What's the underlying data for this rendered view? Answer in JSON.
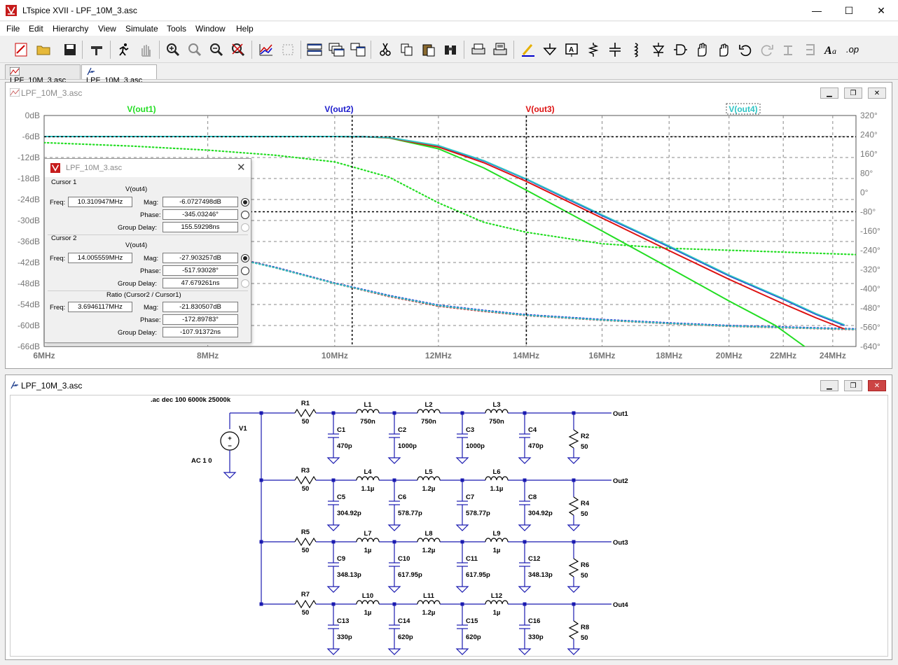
{
  "window": {
    "title": "LTspice XVII - LPF_10M_3.asc",
    "minimize": "—",
    "maximize": "☐",
    "close": "✕"
  },
  "menu": [
    "File",
    "Edit",
    "Hierarchy",
    "View",
    "Simulate",
    "Tools",
    "Window",
    "Help"
  ],
  "tabs": [
    "LPF_10M_3.asc",
    "LPF_10M_3.asc"
  ],
  "plot_window": {
    "title": "LPF_10M_3.asc",
    "colors": {
      "out1": "#22dd22",
      "out2": "#1a1acc",
      "out3": "#dd1111",
      "out4": "#2ec4c4"
    }
  },
  "chart_data": {
    "type": "line",
    "xlabel": "",
    "ylabel": "",
    "x_ticks": [
      "6MHz",
      "8MHz",
      "10MHz",
      "12MHz",
      "14MHz",
      "16MHz",
      "18MHz",
      "20MHz",
      "22MHz",
      "24MHz"
    ],
    "y_ticks": [
      "0dB",
      "-6dB",
      "-12dB",
      "-18dB",
      "-24dB",
      "-30dB",
      "-36dB",
      "-42dB",
      "-48dB",
      "-54dB",
      "-60dB",
      "-66dB"
    ],
    "y2_ticks": [
      "320°",
      "240°",
      "160°",
      "80°",
      "0°",
      "-80°",
      "-160°",
      "-240°",
      "-320°",
      "-400°",
      "-480°",
      "-560°",
      "-640°"
    ],
    "xlim_mhz": [
      6,
      25
    ],
    "ylim_db": [
      -66,
      0
    ],
    "y2lim_deg": [
      -640,
      320
    ],
    "log_x": true,
    "grid": true,
    "series": [
      {
        "name": "V(out1)",
        "color": "#22dd22",
        "mag_db": [
          [
            6,
            -6
          ],
          [
            10,
            -6
          ],
          [
            10.5,
            -6.05
          ],
          [
            11,
            -6.4
          ],
          [
            12,
            -9.5
          ],
          [
            13,
            -15
          ],
          [
            14,
            -21.3
          ],
          [
            16,
            -33
          ],
          [
            18,
            -43.5
          ],
          [
            20,
            -53
          ],
          [
            21.7,
            -60
          ],
          [
            22.9,
            -66.3
          ]
        ],
        "phase_deg": [
          [
            6,
            207
          ],
          [
            7,
            193
          ],
          [
            8,
            176
          ],
          [
            9,
            155
          ],
          [
            10,
            127
          ],
          [
            11,
            64
          ],
          [
            12,
            -43
          ],
          [
            13,
            -124
          ],
          [
            14,
            -165
          ],
          [
            16,
            -213
          ],
          [
            18,
            -232
          ],
          [
            20,
            -240
          ],
          [
            25,
            -258
          ]
        ]
      },
      {
        "name": "V(out2)",
        "color": "#1a1acc",
        "mag_db": [
          [
            6,
            -6
          ],
          [
            10,
            -6
          ],
          [
            10.5,
            -6.03
          ],
          [
            11,
            -6.3
          ],
          [
            12,
            -8.7
          ],
          [
            13,
            -13
          ],
          [
            14,
            -18.2
          ],
          [
            16,
            -28.6
          ],
          [
            18,
            -37.5
          ],
          [
            20,
            -45.8
          ],
          [
            22,
            -52.5
          ],
          [
            23.3,
            -56.8
          ],
          [
            24.5,
            -60
          ]
        ],
        "phase_deg": [
          [
            6,
            -90
          ],
          [
            7,
            -168
          ],
          [
            8,
            -246
          ],
          [
            9,
            -310
          ],
          [
            10,
            -376
          ],
          [
            11,
            -428
          ],
          [
            12,
            -468
          ],
          [
            13,
            -490
          ],
          [
            14,
            -508
          ],
          [
            16,
            -528
          ],
          [
            18,
            -542
          ],
          [
            20,
            -553
          ],
          [
            25,
            -567
          ]
        ]
      },
      {
        "name": "V(out3)",
        "color": "#dd1111",
        "mag_db": [
          [
            6,
            -6
          ],
          [
            10,
            -6
          ],
          [
            10.5,
            -6.04
          ],
          [
            11,
            -6.35
          ],
          [
            12,
            -9
          ],
          [
            13,
            -13.5
          ],
          [
            14,
            -18.8
          ],
          [
            16,
            -29.3
          ],
          [
            18,
            -38.6
          ],
          [
            20,
            -46.8
          ],
          [
            22,
            -53.8
          ],
          [
            23.3,
            -57.8
          ],
          [
            24.5,
            -61
          ]
        ],
        "phase_deg": [
          [
            6,
            -90
          ],
          [
            7,
            -168
          ],
          [
            8,
            -246
          ],
          [
            9,
            -312
          ],
          [
            10,
            -378
          ],
          [
            11,
            -432
          ],
          [
            12,
            -472
          ],
          [
            13,
            -494
          ],
          [
            14,
            -511
          ],
          [
            16,
            -531
          ],
          [
            18,
            -545
          ],
          [
            20,
            -556
          ],
          [
            25,
            -570
          ]
        ]
      },
      {
        "name": "V(out4)",
        "color": "#2ec4c4",
        "mag_db": [
          [
            6,
            -6
          ],
          [
            10,
            -6
          ],
          [
            10.5,
            -6.03
          ],
          [
            11,
            -6.28
          ],
          [
            12,
            -8.6
          ],
          [
            13,
            -12.9
          ],
          [
            14,
            -18.1
          ],
          [
            16,
            -28.4
          ],
          [
            18,
            -37.3
          ],
          [
            20,
            -45.6
          ],
          [
            22,
            -52.3
          ],
          [
            23.3,
            -56.6
          ],
          [
            24.5,
            -59.8
          ]
        ],
        "phase_deg": [
          [
            6,
            -92
          ],
          [
            7,
            -170
          ],
          [
            8,
            -248
          ],
          [
            9,
            -312
          ],
          [
            10,
            -378
          ],
          [
            11,
            -430
          ],
          [
            12,
            -470
          ],
          [
            13,
            -492
          ],
          [
            14,
            -510
          ],
          [
            16,
            -530
          ],
          [
            18,
            -544
          ],
          [
            20,
            -555
          ],
          [
            25,
            -569
          ]
        ]
      }
    ],
    "cursors": {
      "cursor1_mhz": 10.310947,
      "cursor1_db": -6.07,
      "cursor2_mhz": 14.005559,
      "cursor2_deg": -80
    }
  },
  "cursor_dialog": {
    "title": "LPF_10M_3.asc",
    "c1": {
      "header": "Cursor 1",
      "trace": "V(out4)",
      "freq_label": "Freq:",
      "freq": "10.310947MHz",
      "mag_label": "Mag:",
      "mag": "-6.0727498dB",
      "phase_label": "Phase:",
      "phase": "-345.03246°",
      "gd_label": "Group Delay:",
      "gd": "155.59298ns"
    },
    "c2": {
      "header": "Cursor 2",
      "trace": "V(out4)",
      "freq_label": "Freq:",
      "freq": "14.005559MHz",
      "mag_label": "Mag:",
      "mag": "-27.903257dB",
      "phase_label": "Phase:",
      "phase": "-517.93028°",
      "gd_label": "Group Delay:",
      "gd": "47.679261ns"
    },
    "ratio": {
      "header": "Ratio (Cursor2 / Cursor1)",
      "freq_label": "Freq:",
      "freq": "3.6946117MHz",
      "mag_label": "Mag:",
      "mag": "-21.830507dB",
      "phase_label": "Phase:",
      "phase": "-172.89783°",
      "gd_label": "Group Delay:",
      "gd": "-107.91372ns"
    }
  },
  "schematic_window": {
    "title": "LPF_10M_3.asc",
    "directive": ".ac dec 100 6000k 25000k",
    "source": {
      "name": "V1",
      "value": "AC 1 0"
    },
    "rows": [
      {
        "out": "Out1",
        "r_in": [
          "R1",
          "50"
        ],
        "r_load": [
          "R2",
          "50"
        ],
        "L": [
          [
            "L1",
            "750n"
          ],
          [
            "L2",
            "750n"
          ],
          [
            "L3",
            "750n"
          ]
        ],
        "C": [
          [
            "C1",
            "470p"
          ],
          [
            "C2",
            "1000p"
          ],
          [
            "C3",
            "1000p"
          ],
          [
            "C4",
            "470p"
          ]
        ]
      },
      {
        "out": "Out2",
        "r_in": [
          "R3",
          "50"
        ],
        "r_load": [
          "R4",
          "50"
        ],
        "L": [
          [
            "L4",
            "1.1µ"
          ],
          [
            "L5",
            "1.2µ"
          ],
          [
            "L6",
            "1.1µ"
          ]
        ],
        "C": [
          [
            "C5",
            "304.92p"
          ],
          [
            "C6",
            "578.77p"
          ],
          [
            "C7",
            "578.77p"
          ],
          [
            "C8",
            "304.92p"
          ]
        ]
      },
      {
        "out": "Out3",
        "r_in": [
          "R5",
          "50"
        ],
        "r_load": [
          "R6",
          "50"
        ],
        "L": [
          [
            "L7",
            "1µ"
          ],
          [
            "L8",
            "1.2µ"
          ],
          [
            "L9",
            "1µ"
          ]
        ],
        "C": [
          [
            "C9",
            "348.13p"
          ],
          [
            "C10",
            "617.95p"
          ],
          [
            "C11",
            "617.95p"
          ],
          [
            "C12",
            "348.13p"
          ]
        ]
      },
      {
        "out": "Out4",
        "r_in": [
          "R7",
          "50"
        ],
        "r_load": [
          "R8",
          "50"
        ],
        "L": [
          [
            "L10",
            "1µ"
          ],
          [
            "L11",
            "1.2µ"
          ],
          [
            "L12",
            "1µ"
          ]
        ],
        "C": [
          [
            "C13",
            "330p"
          ],
          [
            "C14",
            "620p"
          ],
          [
            "C15",
            "620p"
          ],
          [
            "C16",
            "330p"
          ]
        ]
      }
    ]
  },
  "icons": [
    "new-schematic-icon",
    "open-icon",
    "save-icon",
    "control-panel-icon",
    "run-icon",
    "halt-icon",
    "zoom-in-icon",
    "zoom-pan-icon",
    "zoom-out-icon",
    "zoom-fit-icon",
    "autorange-icon",
    "pick-visible-icon",
    "tile-horizontal-icon",
    "cascade-icon",
    "tile-vertical-icon",
    "cut-icon",
    "copy-icon",
    "paste-icon",
    "find-icon",
    "print-setup-icon",
    "print-icon",
    "draw-wire-icon",
    "ground-icon",
    "label-net-icon",
    "resistor-icon",
    "capacitor-icon",
    "inductor-icon",
    "diode-icon",
    "component-icon",
    "move-icon",
    "drag-icon",
    "undo-icon",
    "redo-icon",
    "rotate-icon",
    "mirror-icon",
    "text-icon",
    "spice-directive-icon"
  ]
}
